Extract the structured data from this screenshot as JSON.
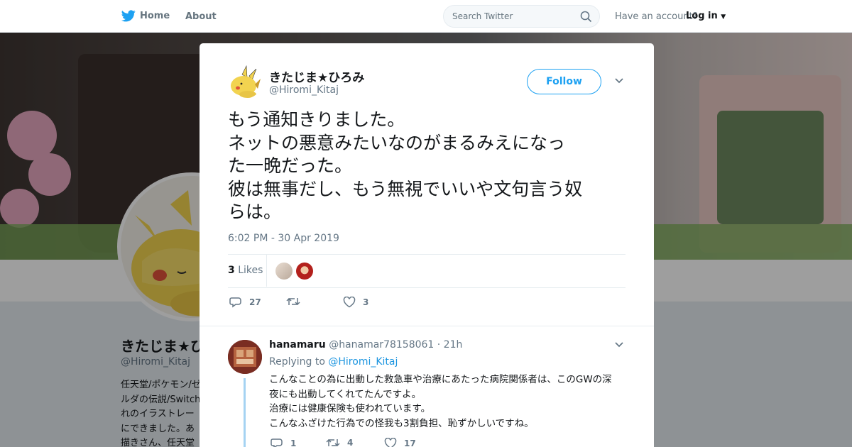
{
  "nav": {
    "home_label": "Home",
    "about_label": "About",
    "search_placeholder": "Search Twitter",
    "account_prompt": "Have an account?",
    "login_label": "Log in"
  },
  "background_profile": {
    "name": "きたじま★ひろみ",
    "handle": "@Hiromi_Kitaj",
    "bio_lines": [
      "任天堂/ポケモン/ゼ",
      "ルダの伝説/Switch",
      "れのイラストレー",
      "にできました。あ",
      "描きさん、任天堂"
    ]
  },
  "tweet": {
    "author_name": "きたじま★ひろみ",
    "author_handle": "@Hiromi_Kitaj",
    "follow_label": "Follow",
    "text_lines": [
      "もう通知きりました。",
      "ネットの悪意みたいなのがまるみえになっ",
      "た一晩だった。",
      "彼は無事だし、もう無視でいいや文句言う奴",
      "らは。"
    ],
    "timestamp": "6:02 PM - 30 Apr 2019",
    "likes_count": "3",
    "likes_label": "Likes",
    "reply_count": "27",
    "retweet_count": "",
    "like_count": "3"
  },
  "reply": {
    "author_name": "hanamaru",
    "author_handle": "@hanamar78158061",
    "time_ago": "· 21h",
    "replying_prefix": "Replying to",
    "replying_to": "@Hiromi_Kitaj",
    "text_lines": [
      "こんなことの為に出動した救急車や治療にあたった病院関係者は、このGWの深",
      "夜にも出動してくれてたんですよ。",
      "治療には健康保険も使われています。",
      "こんなふざけた行為での怪我も3割負担、恥ずかしいですね。"
    ],
    "reply_count": "1",
    "retweet_count": "4",
    "like_count": "17"
  },
  "colors": {
    "accent": "#1da1f2",
    "text_primary": "#14171a",
    "text_secondary": "#657786"
  },
  "icons": [
    "twitter-bird-icon",
    "search-icon",
    "close-icon",
    "chevron-down-icon",
    "reply-icon",
    "retweet-icon",
    "heart-icon"
  ]
}
